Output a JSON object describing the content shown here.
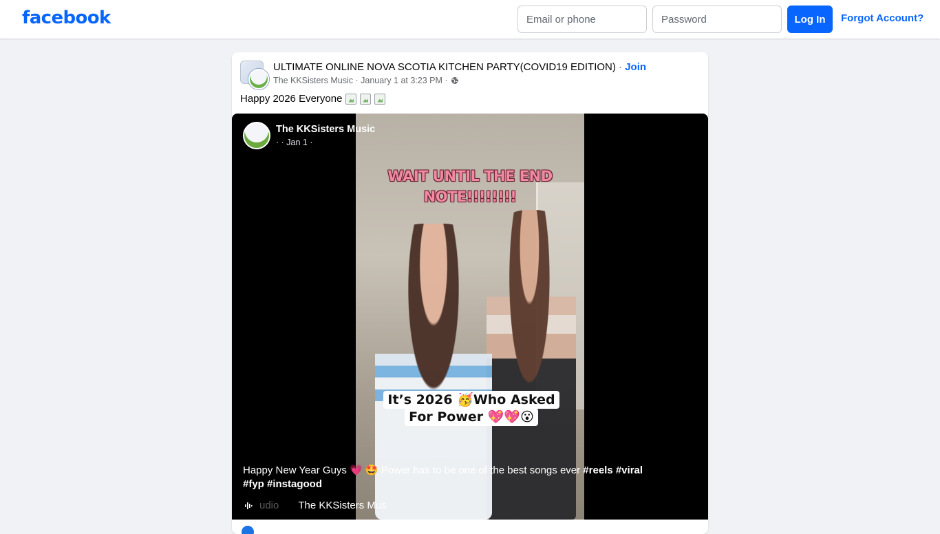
{
  "header": {
    "logo": "facebook",
    "email_placeholder": "Email or phone",
    "password_placeholder": "Password",
    "login_label": "Log In",
    "forgot_label": "Forgot Account?"
  },
  "post": {
    "group_name": "ULTIMATE ONLINE NOVA SCOTIA KITCHEN PARTY(COVID19 EDITION)",
    "separator": "·",
    "join_label": "Join",
    "author_meta": "The KKSisters Music · January 1 at 3:23 PM ·",
    "privacy_icon": "globe-icon",
    "text": "Happy 2026 Everyone"
  },
  "video": {
    "author": "The KKSisters Music",
    "date": "· · Jan 1 ·",
    "overlay_top": "WAIT UNTIL THE END NOTE!!!!!!!!",
    "overlay_caption": "It’s 2026 🥳Who Asked For Power 💖💖😮",
    "description_text": "Happy New Year Guys 💗 🤩 Power has to be one of the best songs ever",
    "description_tags": "#reels #viral #fyp #instagood",
    "audio_label": "udio",
    "audio_name": "The KKSisters Mus",
    "audio_icon": "audio-waveform-icon"
  },
  "colors": {
    "brand": "#0866ff",
    "page_bg": "#f0f2f5"
  }
}
